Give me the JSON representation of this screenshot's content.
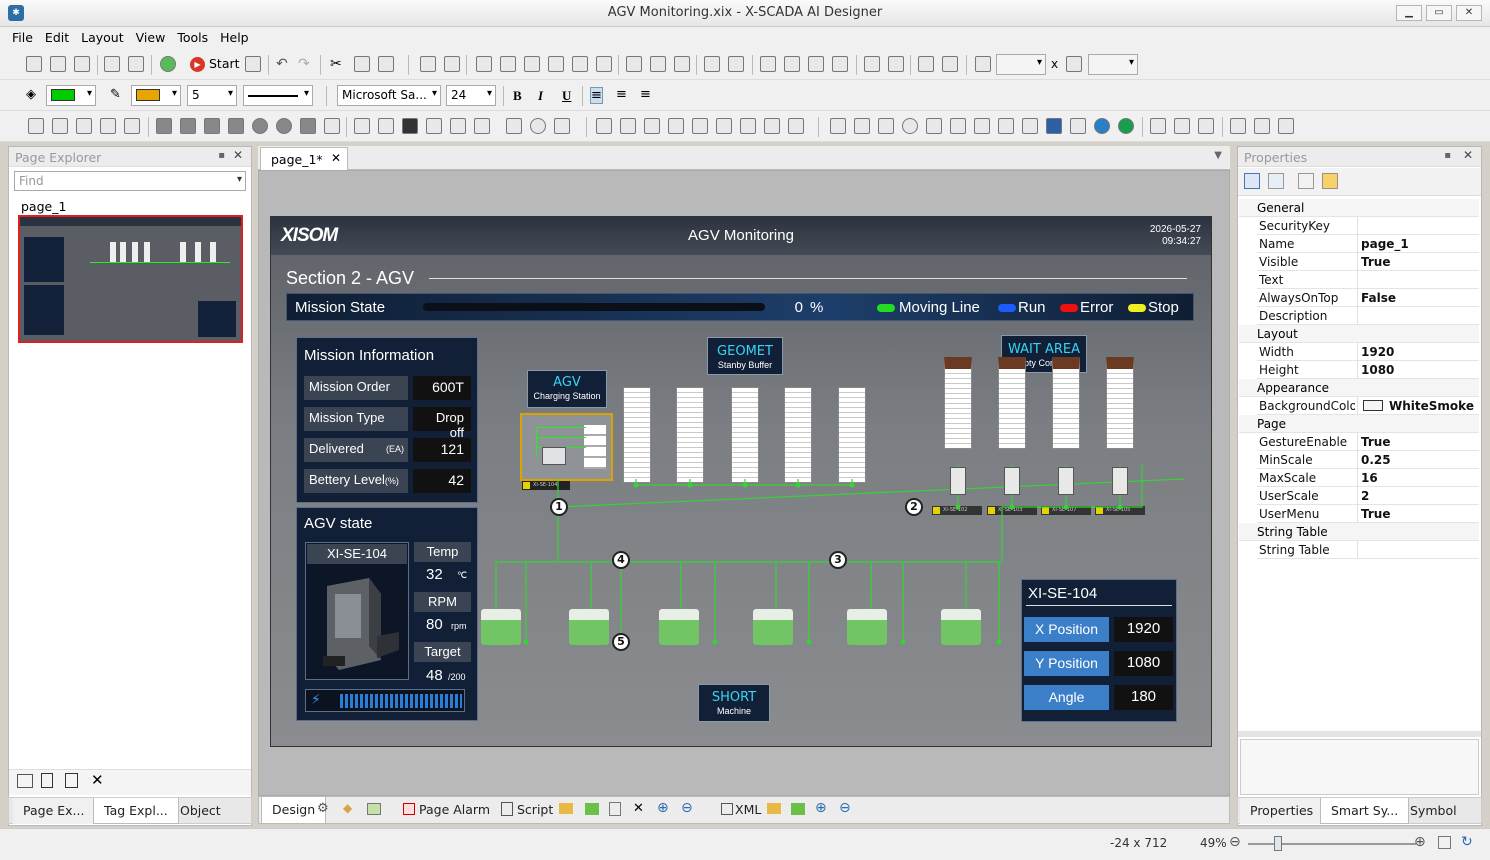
{
  "window": {
    "title": "AGV Monitoring.xix - X-SCADA AI Designer"
  },
  "menu": [
    "File",
    "Edit",
    "Layout",
    "View",
    "Tools",
    "Help"
  ],
  "toolbar": {
    "start_label": "Start",
    "line_width": "5",
    "font_name": "Microsoft Sa...",
    "font_size": "24",
    "size_sep": "x",
    "fill_color": "#00cc00",
    "line_color": "#e8a400"
  },
  "page_explorer": {
    "title": "Page Explorer",
    "find_placeholder": "Find",
    "page_name": "page_1",
    "tabs": [
      "Page Ex...",
      "Tag Expl...",
      "Object E..."
    ]
  },
  "doc_tab": {
    "label": "page_1*"
  },
  "bottom_tabs": {
    "design": "Design",
    "page_alarm": "Page Alarm",
    "script": "Script",
    "xml": "XML"
  },
  "hmi": {
    "logo": "XISOM",
    "title": "AGV Monitoring",
    "date": "2026-05-27",
    "time": "09:34:27",
    "section": "Section 2 - AGV",
    "mission_state": {
      "label": "Mission State",
      "percent": "0",
      "pct_sign": "%",
      "progress": 0
    },
    "legend": [
      {
        "label": "Moving Line",
        "color": "#22dd22"
      },
      {
        "label": "Run",
        "color": "#1a5cff"
      },
      {
        "label": "Error",
        "color": "#ee1111"
      },
      {
        "label": "Stop",
        "color": "#eeee22"
      }
    ],
    "mission_info": {
      "title": "Mission Information",
      "rows": [
        {
          "label": "Mission Order",
          "unit": "",
          "value": "600T"
        },
        {
          "label": "Mission Type",
          "unit": "",
          "value": "Drop off"
        },
        {
          "label": "Delivered",
          "unit": "(EA)",
          "value": "121"
        },
        {
          "label": "Bettery Level",
          "unit": "(%)",
          "value": "42"
        }
      ]
    },
    "agv_state": {
      "title": "AGV state",
      "id": "XI-SE-104",
      "temp_label": "Temp",
      "temp": "32",
      "temp_unit": "℃",
      "rpm_label": "RPM",
      "rpm": "80",
      "rpm_unit": "rpm",
      "target_label": "Target",
      "target": "48",
      "target_unit": "/200"
    },
    "agv_station": {
      "title": "AGV",
      "sub": "Charging Station",
      "tag": "XI-SE-104"
    },
    "geomet": {
      "title": "GEOMET",
      "sub": "Stanby Buffer"
    },
    "wait_area": {
      "title": "WAIT AREA",
      "sub": "Empty Container"
    },
    "short": {
      "title": "SHORT",
      "sub": "Machine"
    },
    "wait_tags": [
      "XI-SE-102",
      "XI-SE-103",
      "XI-SE-107",
      "XI-SE-105"
    ],
    "nodes": [
      "1",
      "2",
      "3",
      "4",
      "5"
    ],
    "position_panel": {
      "title": "XI-SE-104",
      "rows": [
        {
          "label": "X Position",
          "value": "1920"
        },
        {
          "label": "Y Position",
          "value": "1080"
        },
        {
          "label": "Angle",
          "value": "180"
        }
      ]
    }
  },
  "properties": {
    "title": "Properties",
    "categories": {
      "general": "General",
      "layout": "Layout",
      "appearance": "Appearance",
      "page": "Page",
      "string_table": "String Table"
    },
    "general": [
      {
        "k": "SecurityKey",
        "v": ""
      },
      {
        "k": "Name",
        "v": "page_1"
      },
      {
        "k": "Visible",
        "v": "True"
      },
      {
        "k": "Text",
        "v": ""
      },
      {
        "k": "AlwaysOnTop",
        "v": "False"
      },
      {
        "k": "Description",
        "v": ""
      }
    ],
    "layout": [
      {
        "k": "Width",
        "v": "1920"
      },
      {
        "k": "Height",
        "v": "1080"
      }
    ],
    "appearance": [
      {
        "k": "BackgroundColo",
        "v": "WhiteSmoke"
      }
    ],
    "page": [
      {
        "k": "GestureEnable",
        "v": "True"
      },
      {
        "k": "MinScale",
        "v": "0.25"
      },
      {
        "k": "MaxScale",
        "v": "16"
      },
      {
        "k": "UserScale",
        "v": "2"
      },
      {
        "k": "UserMenu",
        "v": "True"
      }
    ],
    "string_table": [
      {
        "k": "String Table",
        "v": ""
      }
    ],
    "tabs": [
      "Properties",
      "Smart Sy...",
      "Symbol ..."
    ]
  },
  "status": {
    "coords": "-24 x 712",
    "zoom": "49%"
  }
}
